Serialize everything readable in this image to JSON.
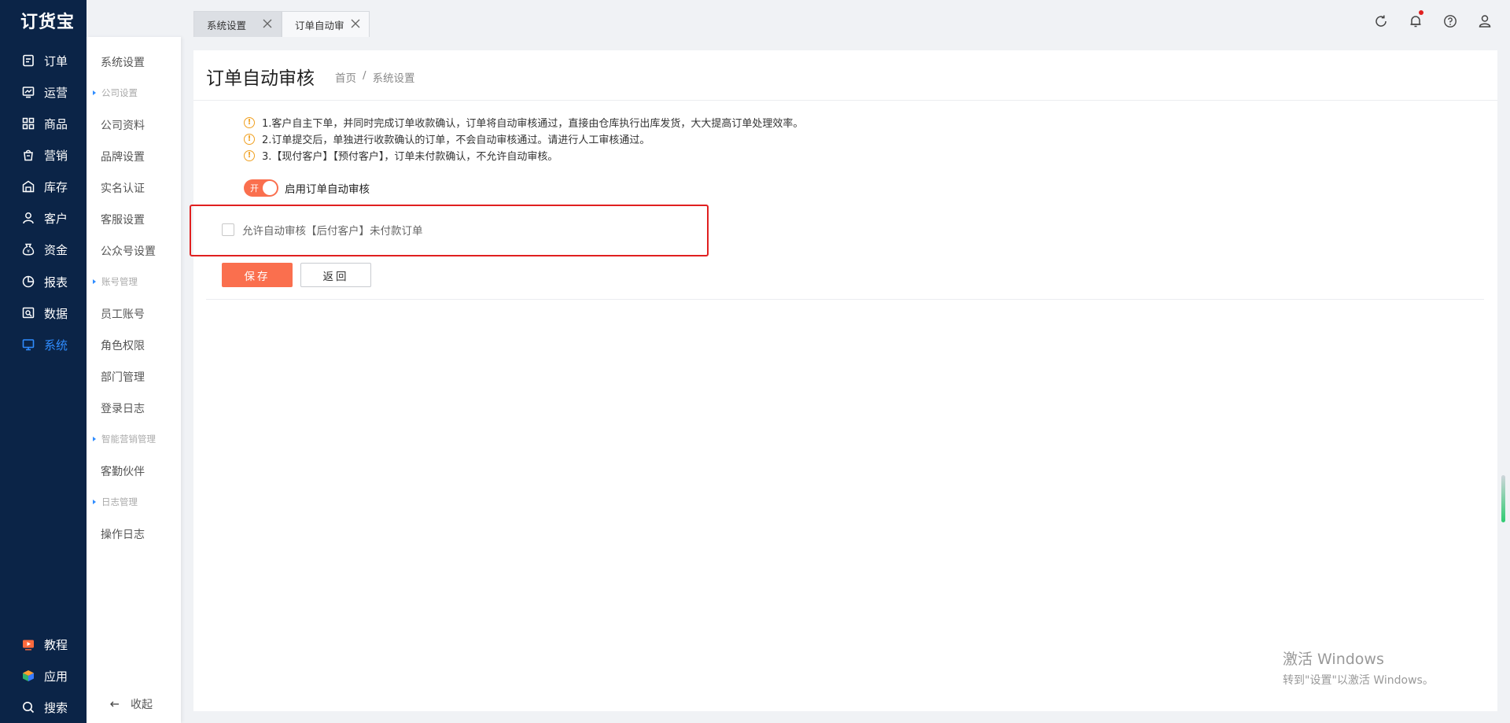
{
  "app": {
    "logo": "订货宝"
  },
  "main_nav": [
    {
      "label": "订单",
      "icon": "order-icon"
    },
    {
      "label": "运营",
      "icon": "operation-icon"
    },
    {
      "label": "商品",
      "icon": "goods-icon"
    },
    {
      "label": "营销",
      "icon": "marketing-icon"
    },
    {
      "label": "库存",
      "icon": "warehouse-icon"
    },
    {
      "label": "客户",
      "icon": "customer-icon"
    },
    {
      "label": "资金",
      "icon": "money-icon"
    },
    {
      "label": "报表",
      "icon": "report-icon"
    },
    {
      "label": "数据",
      "icon": "data-icon"
    },
    {
      "label": "系统",
      "icon": "system-icon",
      "active": true
    }
  ],
  "bottom_nav": [
    {
      "label": "教程",
      "icon": "tutorial-icon"
    },
    {
      "label": "应用",
      "icon": "apps-icon"
    },
    {
      "label": "搜索",
      "icon": "search-icon"
    }
  ],
  "sub_nav": {
    "top": "系统设置",
    "groups": [
      "公司设置",
      "账号管理",
      "智能营销管理",
      "日志管理"
    ],
    "items": [
      "公司资料",
      "品牌设置",
      "实名认证",
      "客服设置",
      "公众号设置",
      "员工账号",
      "角色权限",
      "部门管理",
      "登录日志",
      "客勤伙伴",
      "操作日志"
    ],
    "collapse": "收起"
  },
  "tabs": [
    {
      "label": "系统设置"
    },
    {
      "label": "订单自动审",
      "active": true
    }
  ],
  "header_icons": [
    "refresh-icon",
    "bell-icon",
    "help-icon",
    "user-icon"
  ],
  "page": {
    "title": "订单自动审核",
    "breadcrumb": [
      "首页",
      "系统设置"
    ],
    "breadcrumb_sep": "/",
    "notes": [
      "1.客户自主下单，并同时完成订单收款确认，订单将自动审核通过，直接由仓库执行出库发货，大大提高订单处理效率。",
      "2.订单提交后，单独进行收款确认的订单，不会自动审核通过。请进行人工审核通过。",
      "3.【现付客户】【预付客户】，订单未付款确认，不允许自动审核。"
    ],
    "warn_glyph": "!",
    "switch_label": "开",
    "switch_text": "启用订单自动审核",
    "switch_on": true,
    "checkbox_text": "允许自动审核【后付客户】未付款订单",
    "checkbox_checked": false,
    "save_button": "保存",
    "back_button": "返回"
  },
  "watermark": {
    "line1": "激活 Windows",
    "line2": "转到\"设置\"以激活 Windows。"
  },
  "colors": {
    "nav_bg": "#0b2447",
    "accent": "#fa6f4e",
    "active_nav": "#2f8cff",
    "highlight": "#e02020"
  }
}
